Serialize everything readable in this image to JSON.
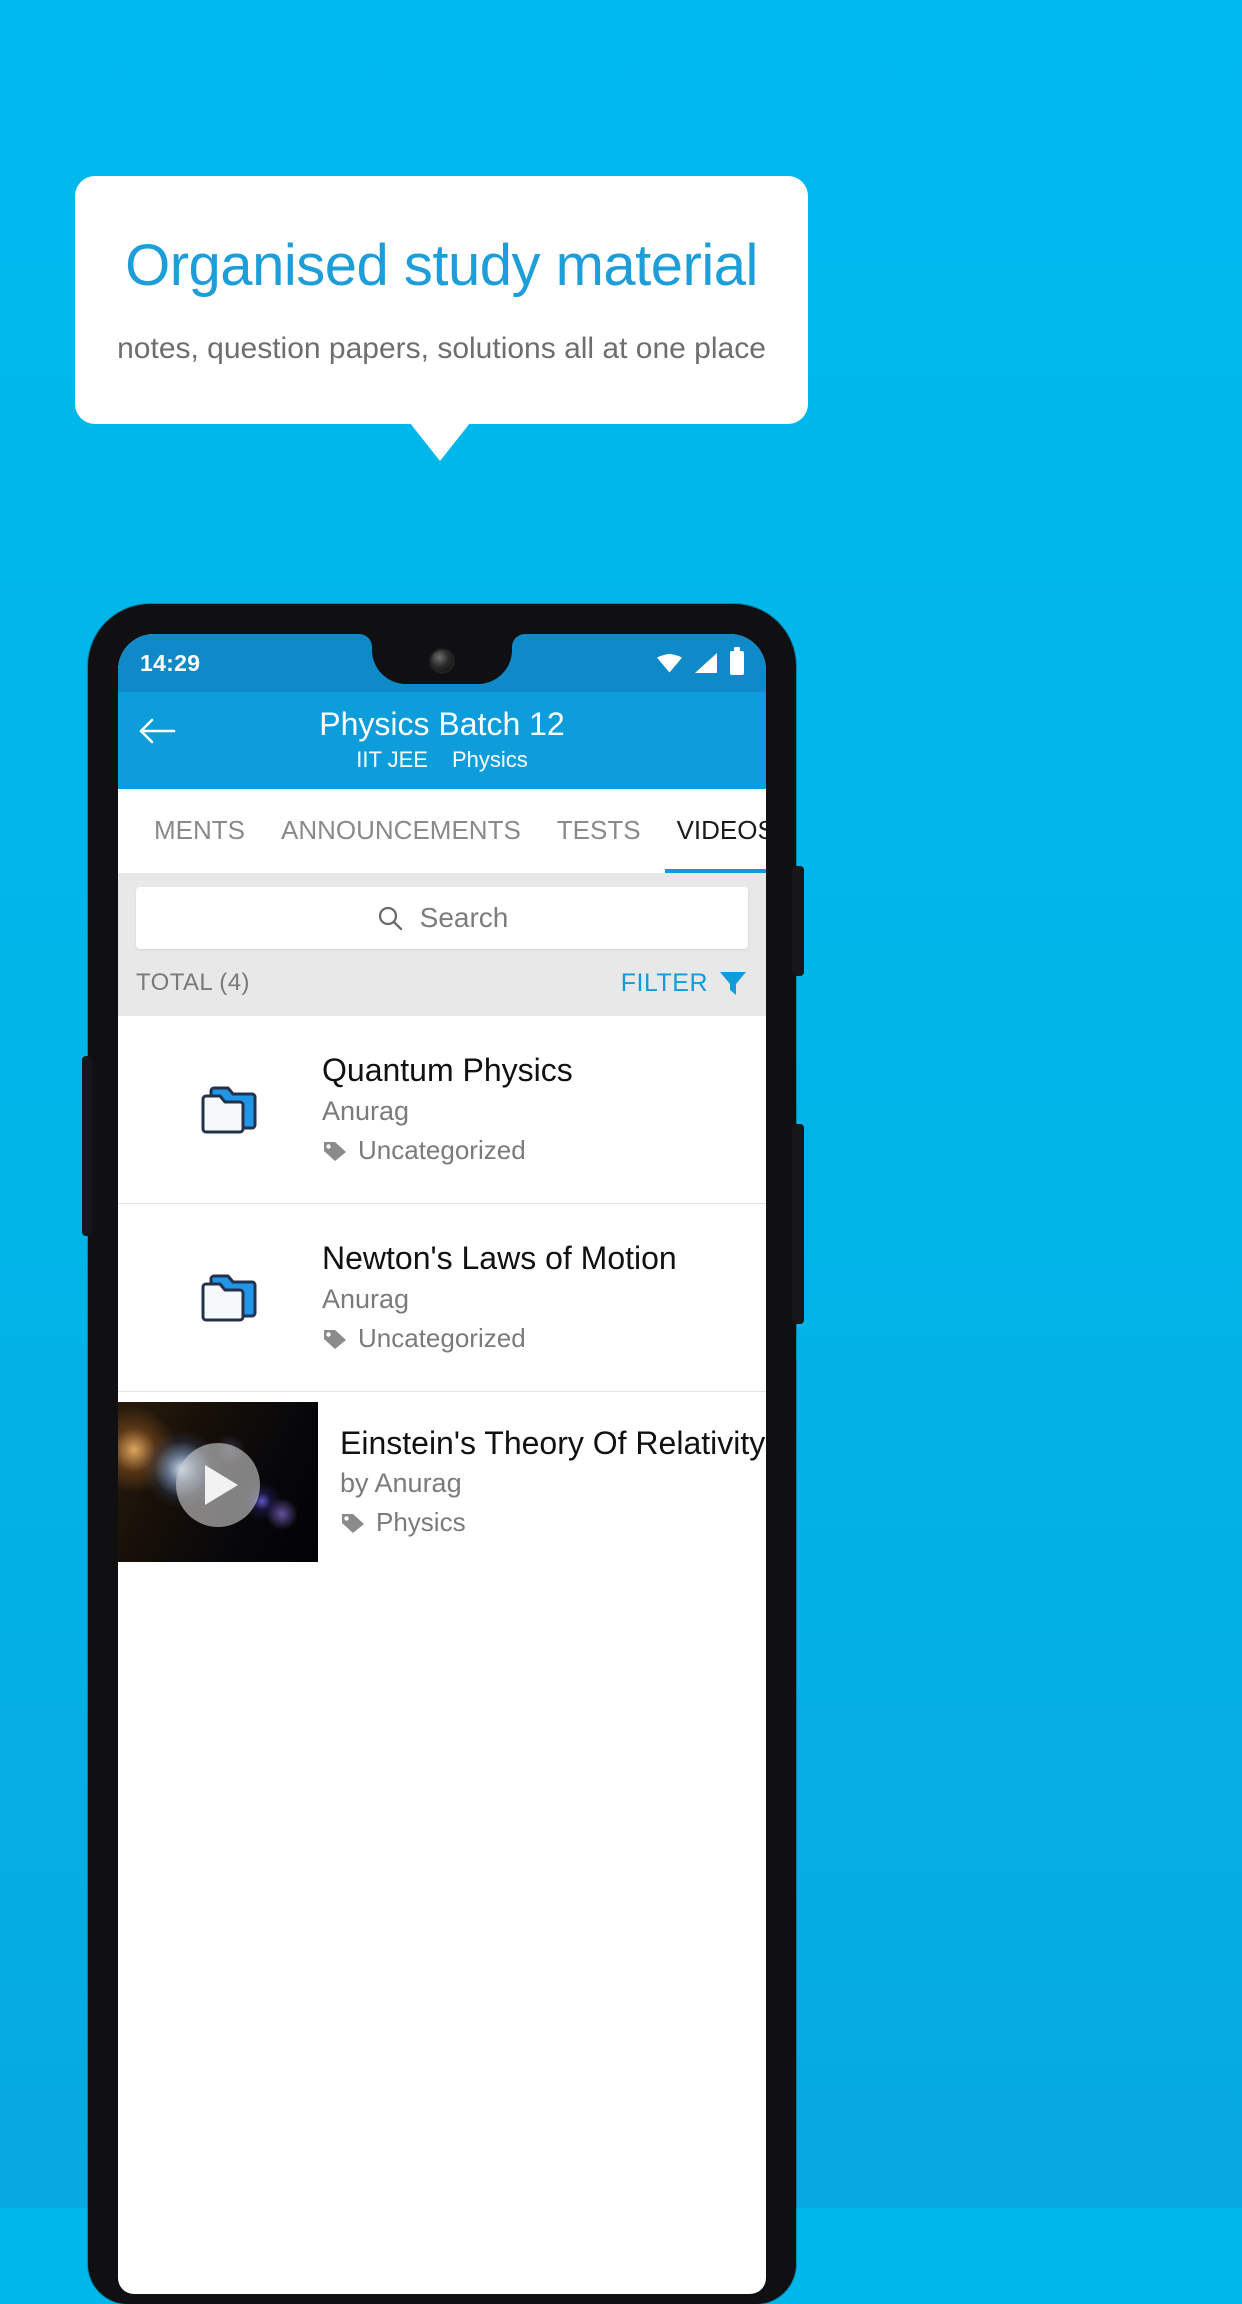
{
  "promo": {
    "title": "Organised study material",
    "subtitle": "notes, question papers, solutions all at one place",
    "title_color": "#1d9ed9"
  },
  "phone": {
    "status_bar": {
      "time": "14:29",
      "icons": [
        "wifi-icon",
        "signal-icon",
        "battery-icon"
      ]
    },
    "app_bar": {
      "back_icon": "back-arrow-icon",
      "title": "Physics Batch 12",
      "subtitle_exam": "IIT JEE",
      "subtitle_subject": "Physics",
      "bg_color": "#0d9ddb"
    },
    "tabs": [
      {
        "label": "MENTS",
        "active": false
      },
      {
        "label": "ANNOUNCEMENTS",
        "active": false
      },
      {
        "label": "TESTS",
        "active": false
      },
      {
        "label": "VIDEOS",
        "active": true
      }
    ],
    "search": {
      "placeholder": "Search",
      "icon": "search-icon"
    },
    "meta": {
      "total_label": "TOTAL (4)",
      "filter_label": "FILTER",
      "filter_icon": "filter-funnel-icon",
      "accent_color": "#0d9ddb"
    },
    "list": [
      {
        "type": "folder",
        "icon": "folder-icon",
        "title": "Quantum Physics",
        "author": "Anurag",
        "tag_icon": "tag-icon",
        "tag": "Uncategorized"
      },
      {
        "type": "folder",
        "icon": "folder-icon",
        "title": "Newton's Laws of Motion",
        "author": "Anurag",
        "tag_icon": "tag-icon",
        "tag": "Uncategorized"
      },
      {
        "type": "video",
        "icon": "play-icon",
        "title": "Einstein's Theory Of Relativity",
        "author": "by Anurag",
        "tag_icon": "tag-icon",
        "tag": "Physics"
      }
    ]
  }
}
